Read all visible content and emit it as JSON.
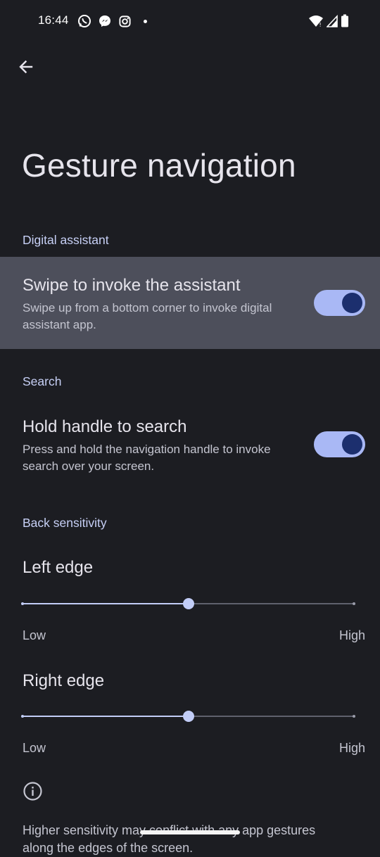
{
  "status_bar": {
    "time": "16:44",
    "notification_icons": [
      "whatsapp-icon",
      "messenger-icon",
      "instagram-icon"
    ],
    "system_icons": [
      "wifi-icon",
      "cell-signal-icon",
      "battery-icon"
    ]
  },
  "header": {
    "back_icon": "arrow-left-icon",
    "title": "Gesture navigation"
  },
  "sections": {
    "digital_assistant": {
      "header": "Digital assistant",
      "setting": {
        "title": "Swipe to invoke the assistant",
        "summary": "Swipe up from a bottom corner to invoke digital assistant app.",
        "enabled": true
      }
    },
    "search": {
      "header": "Search",
      "setting": {
        "title": "Hold handle to search",
        "summary": "Press and hold the navigation handle to invoke search over your screen.",
        "enabled": true
      }
    },
    "back_sensitivity": {
      "header": "Back sensitivity",
      "left_edge": {
        "label": "Left edge",
        "value": 0.5,
        "low_label": "Low",
        "high_label": "High"
      },
      "right_edge": {
        "label": "Right edge",
        "value": 0.5,
        "low_label": "Low",
        "high_label": "High"
      }
    }
  },
  "footer": {
    "info_icon": "info-icon",
    "text": "Higher sensitivity may conflict with any app gestures along the edges of the screen."
  },
  "colors": {
    "background": "#1c1d22",
    "highlight_row": "#4d4f5b",
    "accent": "#a9b8f5",
    "section_header": "#c7d0f6"
  }
}
